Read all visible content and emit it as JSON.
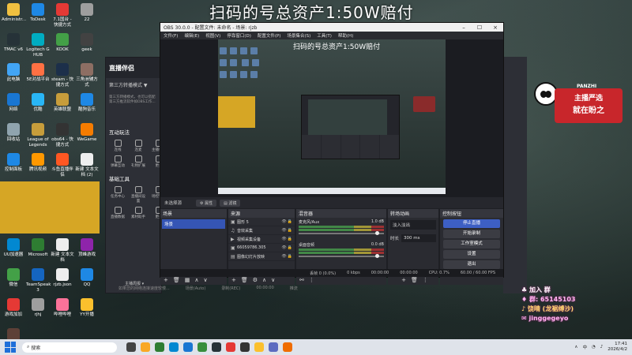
{
  "headline": "扫码的号总资产1:50W赔付",
  "desktop_icons": [
    {
      "label": "Administr...",
      "color": "#f0c040"
    },
    {
      "label": "ToDesk",
      "color": "#1e88e5"
    },
    {
      "label": "7.1国台 - 快捷方式",
      "color": "#e53935"
    },
    {
      "label": "22",
      "color": "#9e9e9e"
    },
    {
      "label": "TMAC v6",
      "color": "#263238"
    },
    {
      "label": "Logitech G HUB",
      "color": "#00acc1"
    },
    {
      "label": "KOOK",
      "color": "#43a047"
    },
    {
      "label": "geek",
      "color": "#424242"
    },
    {
      "label": "此电脑",
      "color": "#42a5f5"
    },
    {
      "label": "5E对战平台",
      "color": "#ff7043"
    },
    {
      "label": "steam - 快捷方式",
      "color": "#1c2f4a"
    },
    {
      "label": "三角洲辅方式",
      "color": "#8d6e63"
    },
    {
      "label": "网络",
      "color": "#1976d2"
    },
    {
      "label": "优酷",
      "color": "#29b6f6"
    },
    {
      "label": "英雄联盟",
      "color": "#c79d3b"
    },
    {
      "label": "酷狗音乐",
      "color": "#1e88e5"
    },
    {
      "label": "回收站",
      "color": "#90a4ae"
    },
    {
      "label": "League of Legends",
      "color": "#c79d3b"
    },
    {
      "label": "obs64 - 快捷方式",
      "color": "#333333"
    },
    {
      "label": "WeGame",
      "color": "#f57c00"
    },
    {
      "label": "控制面板",
      "color": "#1e88e5"
    },
    {
      "label": "腾讯视频",
      "color": "#ff9800"
    },
    {
      "label": "斗鱼直播伴侣",
      "color": "#ff5722"
    },
    {
      "label": "新建 文本文档 (2)",
      "color": "#eeeeee"
    },
    {
      "label": "UU加速器",
      "color": "#0288d1"
    },
    {
      "label": "Microsoft",
      "color": "#2e7d32"
    },
    {
      "label": "新建 文本文档",
      "color": "#eeeeee"
    },
    {
      "label": "顶峰游戏",
      "color": "#8e24aa"
    },
    {
      "label": "微信",
      "color": "#43a047"
    },
    {
      "label": "TeamSpeak 3",
      "color": "#1565c0"
    },
    {
      "label": "rjzb.json",
      "color": "#eeeeee"
    },
    {
      "label": "QQ",
      "color": "#1e88e5"
    },
    {
      "label": "游戏加加",
      "color": "#e53935"
    },
    {
      "label": "rjhj",
      "color": "#9e9e9e"
    },
    {
      "label": "哔哩哔哩",
      "color": "#fb7299"
    },
    {
      "label": "YY开播",
      "color": "#fbc02d"
    },
    {
      "label": "稳能工具",
      "color": "#5d4037"
    }
  ],
  "livesoft": {
    "brand": "直播伴侣",
    "mode": "第三方转播模式 ▼",
    "desc": "第三方转播模式，也可以搭配第三方推流软件如OBS工作...",
    "section_interact": "互动玩法",
    "interact_items": [
      "连线",
      "连麦",
      "主播任务",
      "弹幕互动",
      "礼物扩展",
      "更多"
    ],
    "section_tools": "基础工具",
    "tool_items": [
      "任务中心",
      "直播间设置",
      "场控管理",
      "直播数据",
      "素材助手",
      "更多"
    ],
    "footer": "主播周报 ▾"
  },
  "obs": {
    "title": "OBS 30.0.0 - 配置文件: 未命名 - 场景: rjzb",
    "menu": [
      "文件(F)",
      "编辑(E)",
      "视图(V)",
      "停靠窗口(D)",
      "配置文件(P)",
      "场景集合(S)",
      "工具(T)",
      "帮助(H)"
    ],
    "preview_title": "扫码的号总资产1:50W赔付",
    "scene_bar_label": "未选择源",
    "scene_bar_btn1": "⚙ 属性",
    "scene_bar_btn2": "▤ 滤镜",
    "docks": {
      "scenes": {
        "title": "场景",
        "items": [
          "场景"
        ]
      },
      "sources": {
        "title": "来源",
        "items": [
          "图形 5",
          "音效采集",
          "视频采集设备",
          "66059786.305",
          "图像幻灯片放映"
        ]
      },
      "mixer": {
        "title": "混音器",
        "ch1": "麦克风/Aux",
        "ch1_db": "1.0 dB",
        "ch2": "桌面音频",
        "ch2_db": "0.0 dB"
      },
      "transitions": {
        "title": "转场动画",
        "type": "淡入淡出",
        "dur_label": "时长",
        "dur": "300 ms"
      },
      "controls": {
        "title": "控制按钮",
        "buttons": [
          "停止直播",
          "开始录制",
          "工作室模式",
          "设置",
          "退出"
        ]
      }
    },
    "status": {
      "dropped": "丢帧 0 (0.0%)",
      "kbps": "0 kbps",
      "rec": "00:00:00",
      "live": "00:00:00",
      "cpu": "CPU: 0.7%",
      "fps": "60.00 / 60.00 FPS"
    }
  },
  "below_bar": [
    "如果您的网络连接速度较慢...",
    "场景(Auto)",
    "录制(REC)",
    "00:00:00",
    "推流"
  ],
  "promo": {
    "brand": "PANZHI",
    "line1": "主播严选",
    "line2": "就在盼之"
  },
  "contact": {
    "join": "加入 群",
    "qq": "群: 65145103",
    "tiktok": "饶晴 (龙裾缚沙)",
    "wechat": "jinggegeyo"
  },
  "taskbar": {
    "search": "搜索",
    "time": "17:41",
    "date": "2026/4/2"
  }
}
